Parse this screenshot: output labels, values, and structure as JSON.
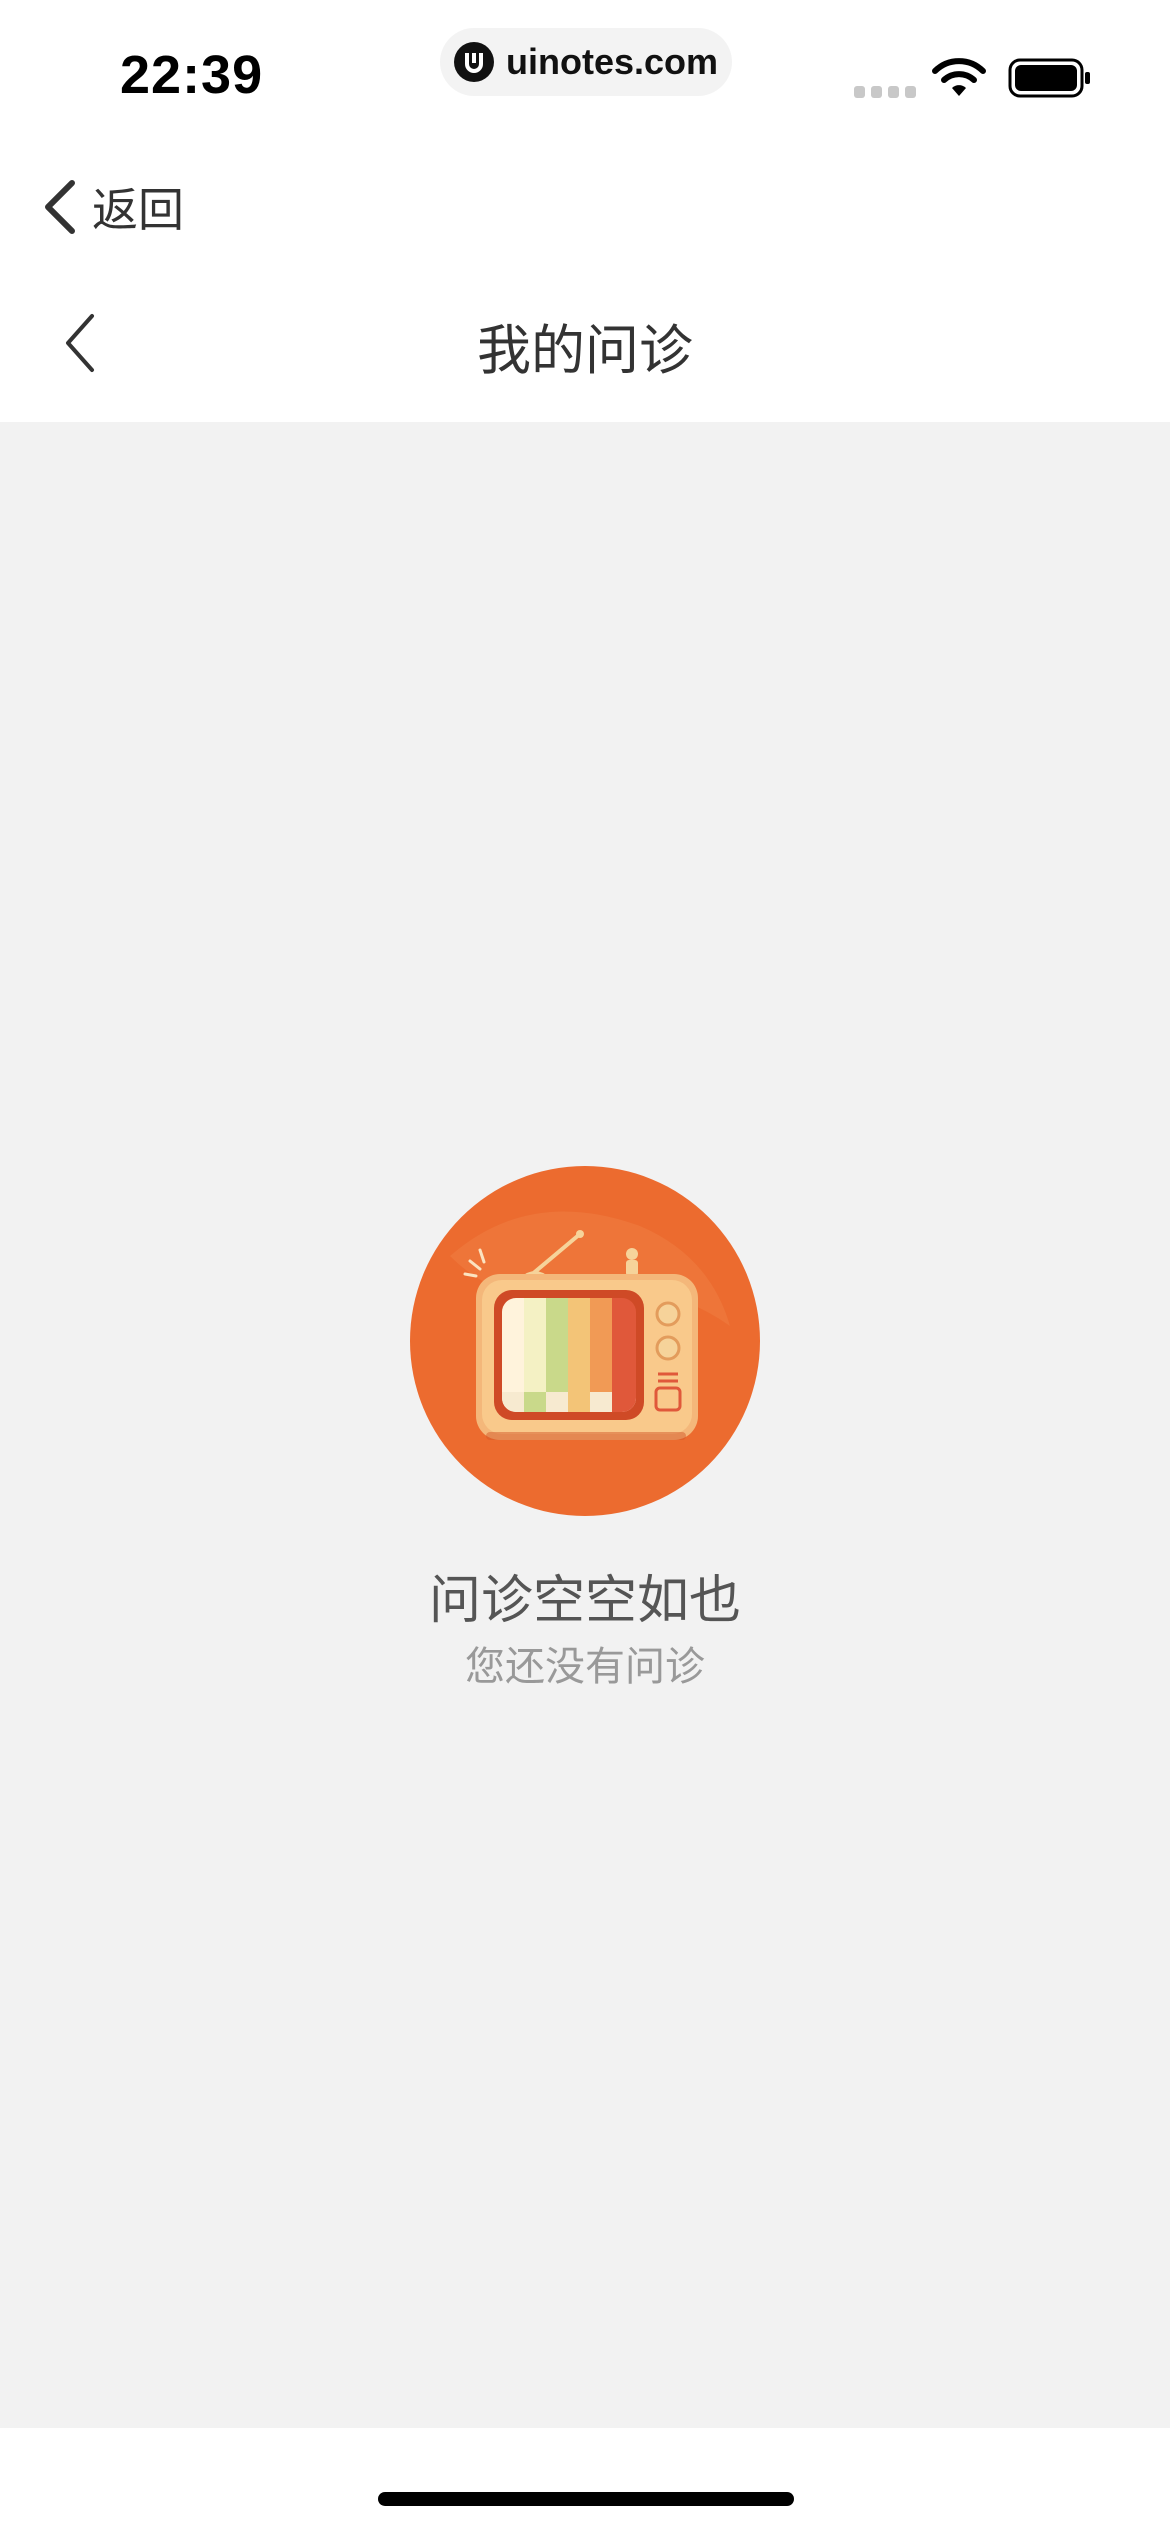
{
  "status_bar": {
    "time": "22:39",
    "url": "uinotes.com",
    "icons": [
      "signal-icon",
      "wifi-icon",
      "battery-icon"
    ]
  },
  "back_row": {
    "label": "返回"
  },
  "nav": {
    "title": "我的问诊"
  },
  "empty_state": {
    "title": "问诊空空如也",
    "subtitle": "您还没有问诊",
    "illustration": "tv-illustration-icon"
  },
  "colors": {
    "background": "#f2f2f2",
    "accent": "#ec6b2f",
    "title_text": "#555555",
    "subtitle_text": "#999999"
  }
}
